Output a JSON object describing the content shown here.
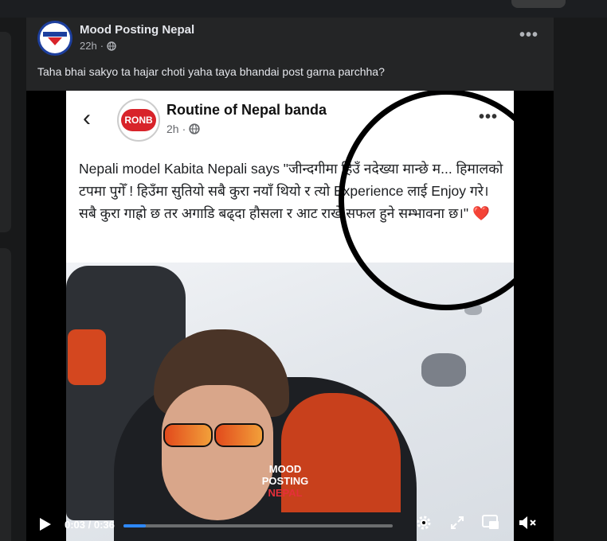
{
  "post": {
    "page_name": "Mood Posting Nepal",
    "time": "22h",
    "meta_separator": "·",
    "caption": "Taha bhai sakyo ta hajar choti yaha taya bhandai post garna parchha?"
  },
  "inner_post": {
    "page_name": "Routine of Nepal banda",
    "time": "2h",
    "meta_separator": "·",
    "avatar_text": "RONB",
    "text": "Nepali model Kabita Nepali says \"जीन्दगीमा हिउँ नदेख्या मान्छे म... हिमालको टपमा पुगेँ ! हिउँमा सुतियो सबै कुरा नयाँ थियो र त्यो Experience लाई Enjoy गरे। सबै कुरा गाह्रो छ तर अगाडि बढ्दा हौसला र आट राखे सफल हुने सम्भावना छ।\"",
    "heart": "❤️"
  },
  "watermark": {
    "line1": "MOOD",
    "line2": "POSTING",
    "line3": "NEPAL"
  },
  "video": {
    "time_current": "0:03",
    "time_separator": " / ",
    "time_total": "0:36",
    "progress": 0.083
  },
  "icons": [
    "globe-icon",
    "more-icon",
    "back-chevron-icon",
    "play-icon",
    "settings-gear-icon",
    "fullscreen-icon",
    "pip-icon",
    "volume-muted-icon"
  ],
  "colors": {
    "background": "#18191a",
    "card": "#242526",
    "text_primary": "#e4e6eb",
    "text_secondary": "#b0b3b8",
    "progress": "#2d88ff",
    "ronb_red": "#d8232a",
    "heart": "#e0245e"
  }
}
